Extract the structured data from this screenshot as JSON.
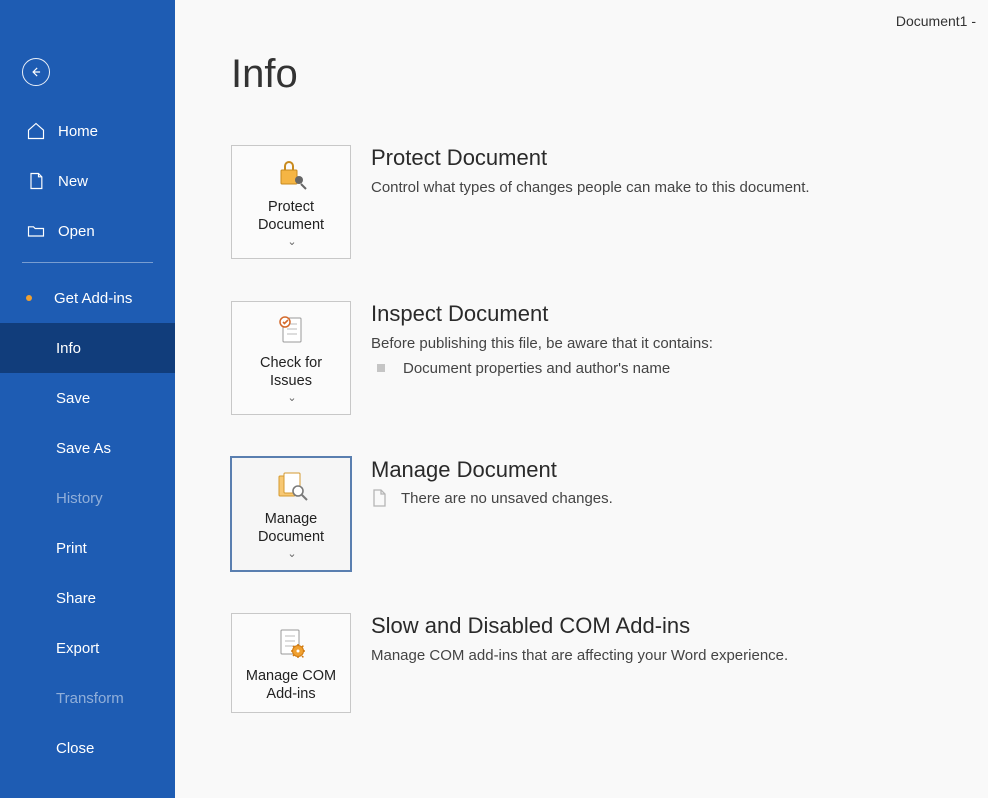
{
  "doc_title": "Document1  -",
  "page_title": "Info",
  "sidebar": {
    "primary": [
      {
        "label": "Home"
      },
      {
        "label": "New"
      },
      {
        "label": "Open"
      }
    ],
    "addins": {
      "label": "Get Add-ins"
    },
    "secondary": [
      {
        "label": "Info",
        "selected": true
      },
      {
        "label": "Save"
      },
      {
        "label": "Save As"
      },
      {
        "label": "History",
        "disabled": true
      },
      {
        "label": "Print"
      },
      {
        "label": "Share"
      },
      {
        "label": "Export"
      },
      {
        "label": "Transform",
        "disabled": true
      },
      {
        "label": "Close"
      }
    ]
  },
  "sections": {
    "protect": {
      "tile_label": "Protect Document",
      "title": "Protect Document",
      "desc": "Control what types of changes people can make to this document."
    },
    "inspect": {
      "tile_label": "Check for Issues",
      "title": "Inspect Document",
      "desc": "Before publishing this file, be aware that it contains:",
      "issues": [
        "Document properties and author's name"
      ]
    },
    "manage": {
      "tile_label": "Manage Document",
      "title": "Manage Document",
      "status": "There are no unsaved changes."
    },
    "com": {
      "tile_label": "Manage COM Add-ins",
      "title": "Slow and Disabled COM Add-ins",
      "desc": "Manage COM add-ins that are affecting your Word experience."
    }
  }
}
